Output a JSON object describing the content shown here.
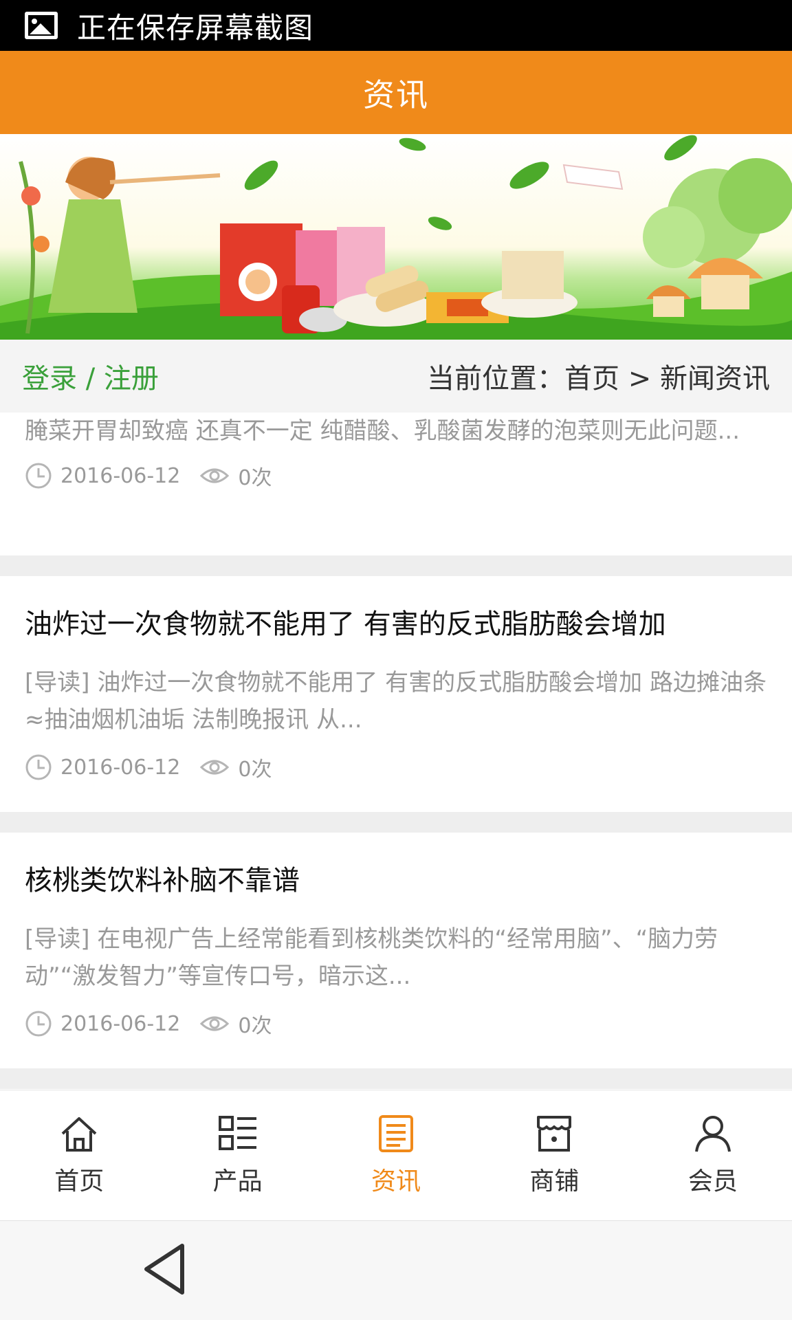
{
  "status_bar": {
    "text": "正在保存屏幕截图",
    "icon": "image-icon"
  },
  "header": {
    "title": "资讯"
  },
  "location_bar": {
    "login": "登录 / 注册",
    "crumb": "当前位置：首页 > 新闻资讯"
  },
  "news": [
    {
      "title": "",
      "summary": " 腌菜开胃却致癌 还真不一定   纯醋酸、乳酸菌发酵的泡菜则无此问题...",
      "date": "2016-06-12",
      "views": "0次"
    },
    {
      "title": "油炸过一次食物就不能用了 有害的反式脂肪酸会增加",
      "summary": "[导读] 油炸过一次食物就不能用了 有害的反式脂肪酸会增加 路边摊油条≈抽油烟机油垢 法制晚报讯 从...",
      "date": "2016-06-12",
      "views": "0次"
    },
    {
      "title": "核桃类饮料补脑不靠谱",
      "summary": "[导读] 在电视广告上经常能看到核桃类饮料的“经常用脑”、“脑力劳动”“激发智力”等宣传口号，暗示这...",
      "date": "2016-06-12",
      "views": "0次"
    }
  ],
  "tabs": [
    {
      "label": "首页",
      "icon": "home-icon"
    },
    {
      "label": "产品",
      "icon": "grid-list-icon"
    },
    {
      "label": "资讯",
      "icon": "news-icon",
      "active": true
    },
    {
      "label": "商铺",
      "icon": "shop-icon"
    },
    {
      "label": "会员",
      "icon": "user-icon"
    }
  ],
  "colors": {
    "accent": "#f08a1a",
    "green": "#3aa03a",
    "muted": "#999999"
  }
}
